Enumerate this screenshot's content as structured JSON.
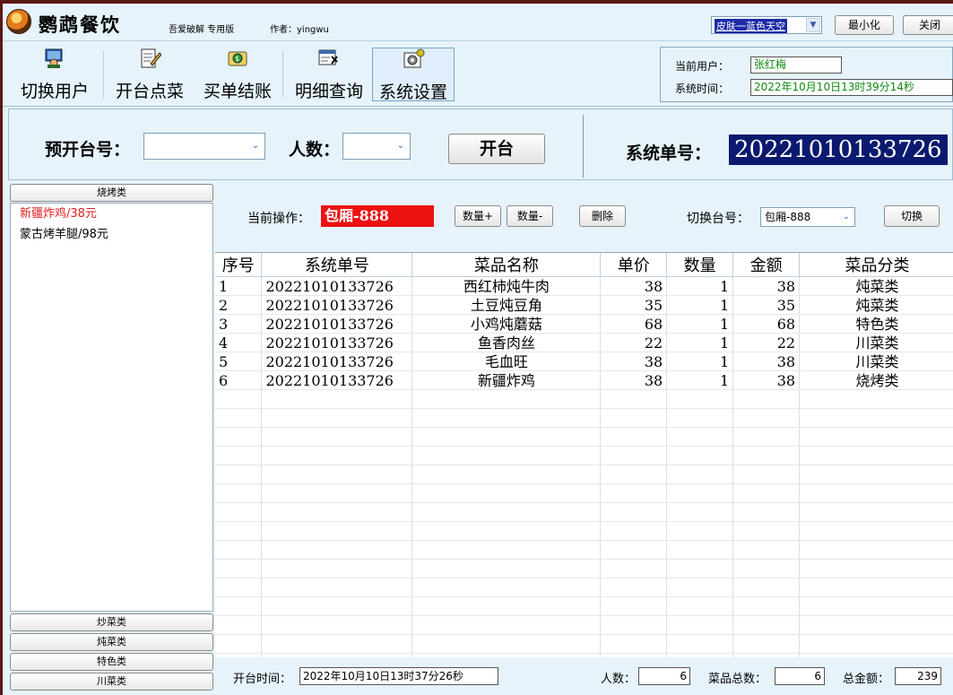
{
  "window": {
    "title": "鹦鹉餐饮",
    "subtitle": "吾爱破解 专用版",
    "author": "作者：yingwu",
    "skin_selected": "皮肤一蓝色天空",
    "minimize_label": "最小化",
    "close_label": "关闭"
  },
  "toolbar": {
    "items": [
      {
        "label": "切换用户",
        "icon": "user-switch-icon"
      },
      {
        "label": "开台点菜",
        "icon": "order-edit-icon"
      },
      {
        "label": "买单结账",
        "icon": "checkout-icon"
      },
      {
        "label": "明细查询",
        "icon": "detail-query-icon"
      },
      {
        "label": "系统设置",
        "icon": "settings-icon"
      }
    ]
  },
  "user_info": {
    "current_user_label": "当前用户：",
    "current_user": "张红梅",
    "system_time_label": "系统时间：",
    "system_time": "2022年10月10日13时39分14秒"
  },
  "header": {
    "table_label": "预开台号：",
    "table_value": "",
    "people_label": "人数：",
    "people_value": "",
    "open_button": "开台",
    "order_no_label": "系统单号：",
    "order_no": "20221010133726"
  },
  "categories": {
    "top": "烧烤类",
    "items": [
      {
        "label": "新疆炸鸡/38元",
        "color": "#e02020"
      },
      {
        "label": "蒙古烤羊腿/98元",
        "color": "#000000"
      }
    ],
    "bottom": [
      "炒菜类",
      "炖菜类",
      "特色类",
      "川菜类"
    ]
  },
  "operations": {
    "current_label": "当前操作：",
    "current_value": "包厢-888",
    "qty_plus": "数量+",
    "qty_minus": "数量-",
    "delete": "删除",
    "switch_table_label": "切换台号：",
    "switch_table_value": "包厢-888",
    "switch_button": "切换"
  },
  "grid": {
    "columns": [
      "序号",
      "系统单号",
      "菜品名称",
      "单价",
      "数量",
      "金额",
      "菜品分类"
    ],
    "rows": [
      [
        "1",
        "20221010133726",
        "西红柿炖牛肉",
        "38",
        "1",
        "38",
        "炖菜类"
      ],
      [
        "2",
        "20221010133726",
        "土豆炖豆角",
        "35",
        "1",
        "35",
        "炖菜类"
      ],
      [
        "3",
        "20221010133726",
        "小鸡炖蘑菇",
        "68",
        "1",
        "68",
        "特色类"
      ],
      [
        "4",
        "20221010133726",
        "鱼香肉丝",
        "22",
        "1",
        "22",
        "川菜类"
      ],
      [
        "5",
        "20221010133726",
        "毛血旺",
        "38",
        "1",
        "38",
        "川菜类"
      ],
      [
        "6",
        "20221010133726",
        "新疆炸鸡",
        "38",
        "1",
        "38",
        "烧烤类"
      ]
    ],
    "empty_rows": 15
  },
  "footer": {
    "open_time_label": "开台时间：",
    "open_time": "2022年10月10日13时37分26秒",
    "people_label": "人数：",
    "people": "6",
    "dish_total_label": "菜品总数：",
    "dish_total": "6",
    "amount_label": "总金额：",
    "amount": "239"
  }
}
